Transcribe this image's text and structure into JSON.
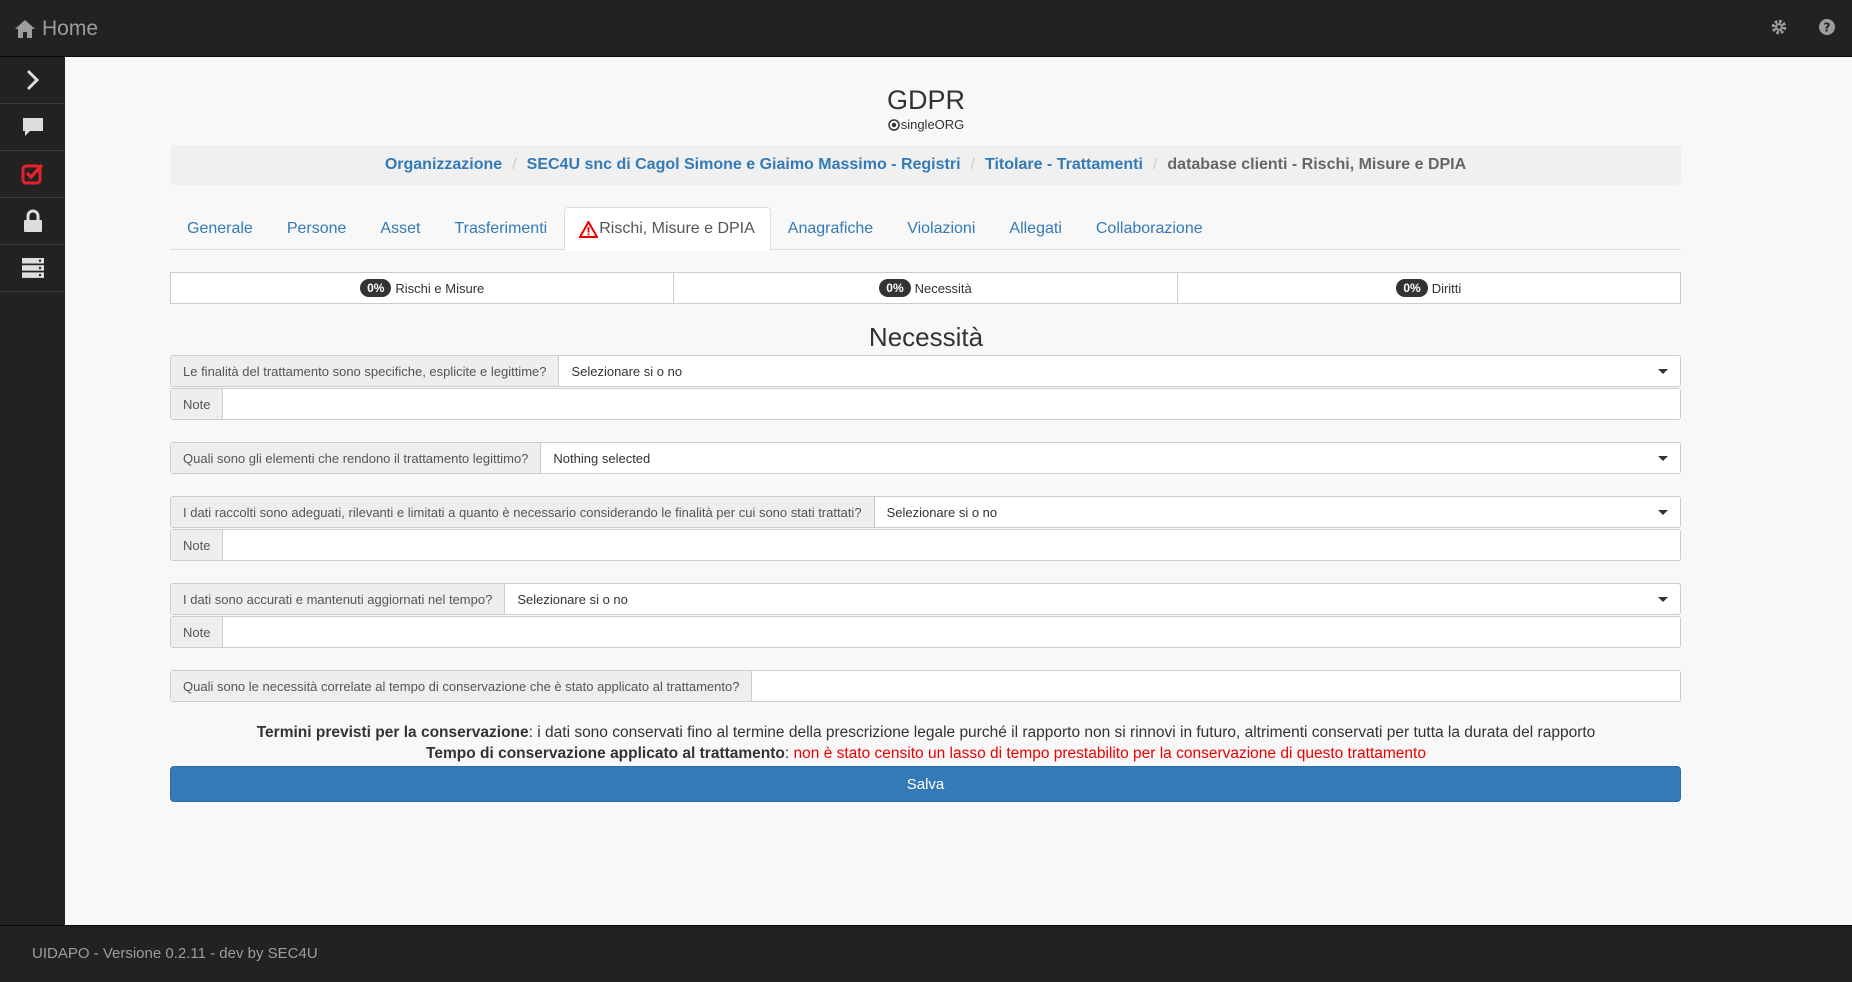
{
  "topbar": {
    "home_label": "Home",
    "icons": [
      "home-icon",
      "gear-icon",
      "question-icon"
    ]
  },
  "sidebar": {
    "items": [
      {
        "icon": "chevron-right-icon"
      },
      {
        "icon": "chat-icon"
      },
      {
        "icon": "checkbox-icon",
        "color": "#e8202b"
      },
      {
        "icon": "lock-icon"
      },
      {
        "icon": "server-icon"
      }
    ]
  },
  "header": {
    "title": "GDPR",
    "org_label": "singleORG"
  },
  "breadcrumb": {
    "items": [
      "Organizzazione",
      "SEC4U snc di Cagol Simone e Giaimo Massimo - Registri",
      "Titolare - Trattamenti"
    ],
    "active": "database clienti - Rischi, Misure e DPIA"
  },
  "tabs": [
    {
      "label": "Generale"
    },
    {
      "label": "Persone"
    },
    {
      "label": "Asset"
    },
    {
      "label": "Trasferimenti"
    },
    {
      "label": "Rischi, Misure e DPIA",
      "active": true,
      "icon": "warning-icon"
    },
    {
      "label": "Anagrafiche"
    },
    {
      "label": "Violazioni"
    },
    {
      "label": "Allegati"
    },
    {
      "label": "Collaborazione"
    }
  ],
  "progress": [
    {
      "percent": "0%",
      "label": "Rischi e Misure"
    },
    {
      "percent": "0%",
      "label": "Necessità"
    },
    {
      "percent": "0%",
      "label": "Diritti"
    }
  ],
  "section": {
    "title": "Necessità"
  },
  "form": {
    "q1": {
      "label": "Le finalità del trattamento sono specifiche, esplicite e legittime?",
      "value": "Selezionare si o no"
    },
    "q2": {
      "label": "Quali sono gli elementi che rendono il trattamento legittimo?",
      "value": "Nothing selected"
    },
    "q3": {
      "label": "I dati raccolti sono adeguati, rilevanti e limitati a quanto è necessario considerando le finalità per cui sono stati trattati?",
      "value": "Selezionare si o no"
    },
    "q4": {
      "label": "I dati sono accurati e mantenuti aggiornati nel tempo?",
      "value": "Selezionare si o no"
    },
    "q5": {
      "label": "Quali sono le necessità correlate al tempo di conservazione che è stato applicato al trattamento?",
      "value": ""
    },
    "note_label": "Note",
    "note_value": ""
  },
  "info": {
    "line1_bold": "Termini previsti per la conservazione",
    "line1_text": ": i dati sono conservati fino al termine della prescrizione legale purché il rapporto non si rinnovi in futuro, altrimenti conservati per tutta la durata del rapporto",
    "line2_bold": "Tempo di conservazione applicato al trattamento",
    "line2_colon": ": ",
    "line2_red": "non è stato censito un lasso di tempo prestabilito per la conservazione di questo trattamento",
    "red_color": "#e00000"
  },
  "save_label": "Salva",
  "footer": {
    "text": "UIDAPO - Versione 0.2.11 - dev by SEC4U"
  }
}
